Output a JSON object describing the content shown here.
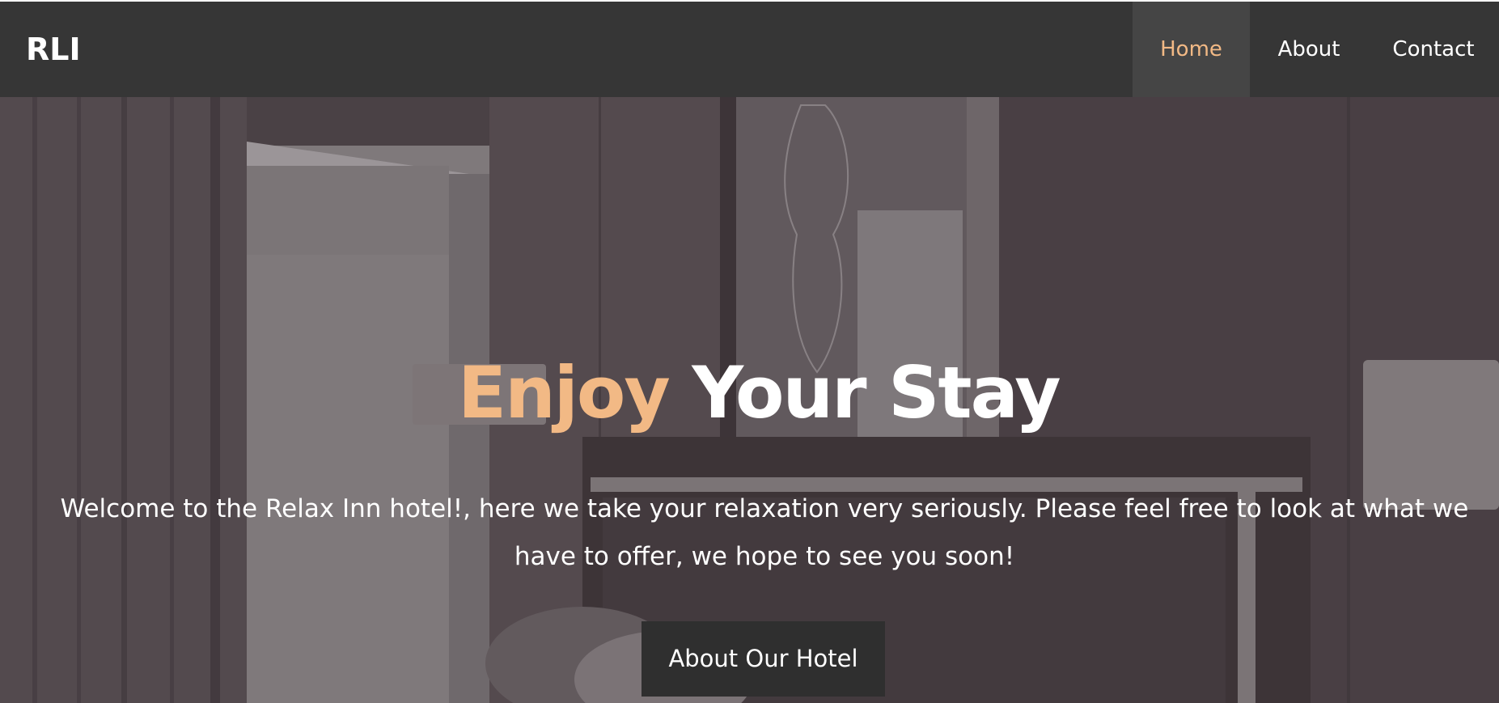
{
  "nav": {
    "brand": "RLI",
    "links": [
      {
        "label": "Home",
        "active": true
      },
      {
        "label": "About",
        "active": false
      },
      {
        "label": "Contact",
        "active": false
      }
    ]
  },
  "hero": {
    "title_accent": "Enjoy",
    "title_rest": " Your Stay",
    "text": "Welcome to the Relax Inn hotel!, here we take your relaxation very seriously. Please feel free to look at what we have to offer, we hope to see you soon!",
    "button_label": "About Our Hotel",
    "background_image": "hotel-room-photo"
  },
  "colors": {
    "nav_bg": "#363636",
    "nav_active_bg": "#454545",
    "accent": "#f2b985",
    "button_bg": "#2f2f2f",
    "hero_overlay": "#4f464a"
  }
}
